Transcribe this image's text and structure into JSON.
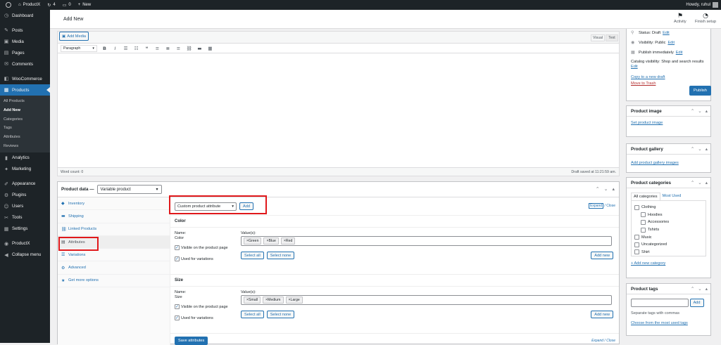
{
  "adminbar": {
    "site": "ProductX",
    "updates": "4",
    "comments": "0",
    "new": "New",
    "howdy": "Howdy, ruhul"
  },
  "sidebar": {
    "items": [
      {
        "icon": "dashboard-icon",
        "glyph": "◷",
        "label": "Dashboard"
      },
      {
        "icon": "pin-icon",
        "glyph": "✎",
        "label": "Posts"
      },
      {
        "icon": "media-icon",
        "glyph": "▣",
        "label": "Media"
      },
      {
        "icon": "pages-icon",
        "glyph": "▤",
        "label": "Pages"
      },
      {
        "icon": "comments-icon",
        "glyph": "✉",
        "label": "Comments"
      },
      {
        "icon": "woocommerce-icon",
        "glyph": "◧",
        "label": "WooCommerce"
      },
      {
        "icon": "products-icon",
        "glyph": "▦",
        "label": "Products"
      },
      {
        "icon": "analytics-icon",
        "glyph": "▮",
        "label": "Analytics"
      },
      {
        "icon": "marketing-icon",
        "glyph": "✦",
        "label": "Marketing"
      },
      {
        "icon": "appearance-icon",
        "glyph": "✐",
        "label": "Appearance"
      },
      {
        "icon": "plugins-icon",
        "glyph": "⚙",
        "label": "Plugins"
      },
      {
        "icon": "users-icon",
        "glyph": "☺",
        "label": "Users"
      },
      {
        "icon": "tools-icon",
        "glyph": "✂",
        "label": "Tools"
      },
      {
        "icon": "settings-icon",
        "glyph": "▦",
        "label": "Settings"
      },
      {
        "icon": "productx-icon",
        "glyph": "◉",
        "label": "ProductX"
      },
      {
        "icon": "collapse-icon",
        "glyph": "◀",
        "label": "Collapse menu"
      }
    ],
    "submenu": [
      "All Products",
      "Add New",
      "Categories",
      "Tags",
      "Attributes",
      "Reviews"
    ]
  },
  "topbar": {
    "title": "Add New",
    "activity": "Activity",
    "finish": "Finish setup"
  },
  "editor": {
    "add_media": "Add Media",
    "visual": "Visual",
    "text": "Text",
    "format": "Paragraph",
    "word_count": "Word count: 0",
    "draft_saved": "Draft saved at 11:21:59 am."
  },
  "product_data": {
    "label": "Product data —",
    "type": "Variable product",
    "tabs": [
      "Inventory",
      "Shipping",
      "Linked Products",
      "Attributes",
      "Variations",
      "Advanced",
      "Get more options"
    ],
    "custom_attr": "Custom product attribute",
    "add": "Add",
    "expand": "Expand",
    "close": "Close",
    "name_label": "Name:",
    "values_label": "Value(s):",
    "visible_label": "Visible on the product page",
    "variations_label": "Used for variations",
    "select_all": "Select all",
    "select_none": "Select none",
    "add_new": "Add new",
    "save": "Save attributes",
    "attributes": [
      {
        "name": "Color",
        "values": [
          "Green",
          "Blue",
          "Red"
        ]
      },
      {
        "name": "Size",
        "values": [
          "Small",
          "Medium",
          "Large"
        ]
      }
    ]
  },
  "publish": {
    "status": "Status: Draft",
    "visibility": "Visibility: Public",
    "publish_when": "Publish immediately",
    "edit": "Edit",
    "catalog": "Catalog visibility: Shop and search results",
    "copy": "Copy to a new draft",
    "trash": "Move to Trash",
    "publish_btn": "Publish"
  },
  "product_image": {
    "title": "Product image",
    "link": "Set product image"
  },
  "product_gallery": {
    "title": "Product gallery",
    "link": "Add product gallery images"
  },
  "categories": {
    "title": "Product categories",
    "tab_all": "All categories",
    "tab_used": "Most Used",
    "items": [
      {
        "label": "Clothing",
        "child": false
      },
      {
        "label": "Hoodies",
        "child": true
      },
      {
        "label": "Accessories",
        "child": true
      },
      {
        "label": "Tshirts",
        "child": true
      },
      {
        "label": "Music",
        "child": false
      },
      {
        "label": "Uncategorized",
        "child": false
      },
      {
        "label": "Shirt",
        "child": false
      }
    ],
    "add_new": "+ Add new category"
  },
  "tags": {
    "title": "Product tags",
    "add": "Add",
    "hint": "Separate tags with commas",
    "choose": "Choose from the most used tags"
  },
  "colors": {
    "accent": "#2271b1",
    "highlight": "#e0181b",
    "admin_dark": "#1d2327"
  }
}
